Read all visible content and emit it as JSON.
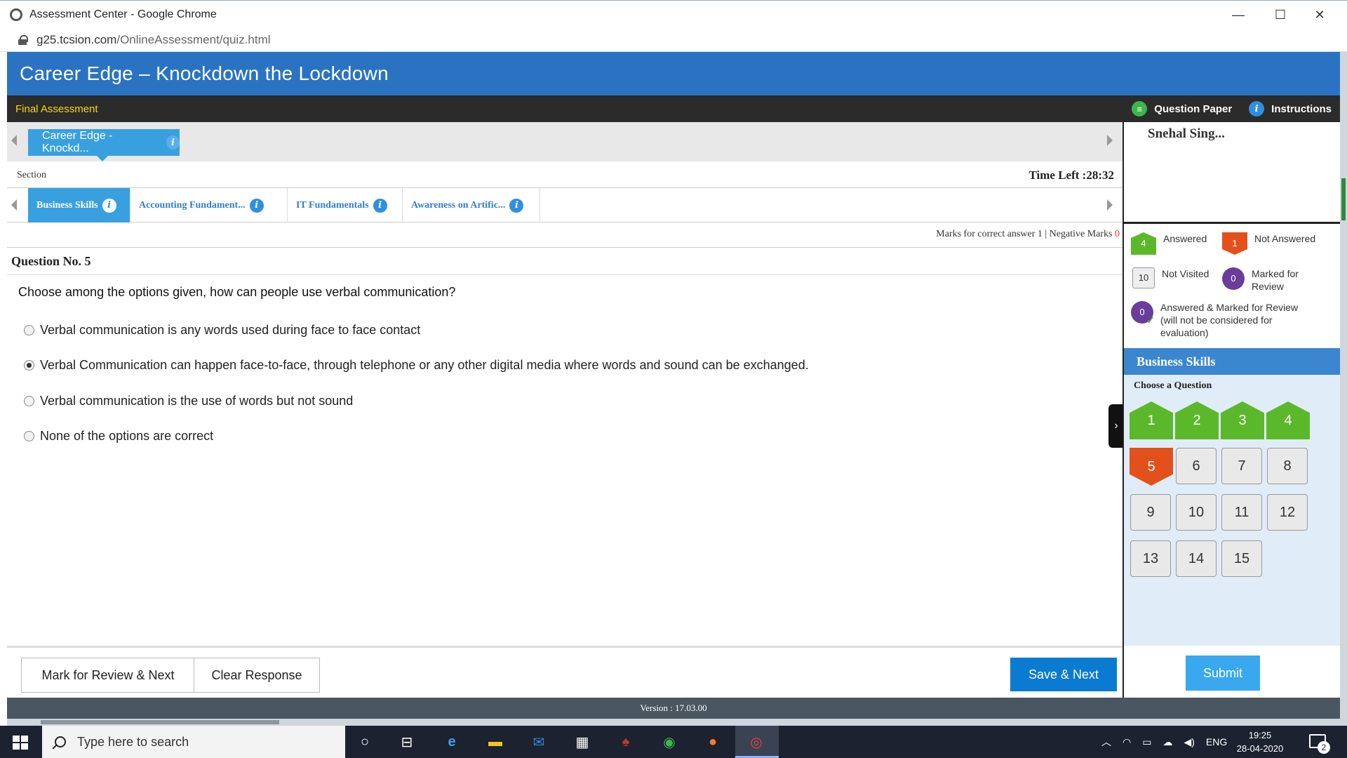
{
  "window": {
    "title": "Assessment Center - Google Chrome",
    "url_domain": "g25.tcsion.com",
    "url_path": "/OnlineAssessment/quiz.html",
    "controls": [
      "—",
      "☐",
      "✕"
    ]
  },
  "header": {
    "brand": "Career Edge – Knockdown the Lockdown",
    "assessment": "Final Assessment",
    "question_paper": "Question Paper",
    "instructions": "Instructions"
  },
  "test": {
    "tab": "Career Edge - Knockd...",
    "section_label": "Section",
    "time_left": "Time Left :28:32"
  },
  "sections": [
    {
      "label": "Business Skills",
      "active": true
    },
    {
      "label": "Accounting Fundament...",
      "active": false
    },
    {
      "label": "IT Fundamentals",
      "active": false
    },
    {
      "label": "Awareness on Artific...",
      "active": false
    }
  ],
  "marks": {
    "correct_label": "Marks for correct answer",
    "correct_value": "1",
    "separator": "|",
    "negative_label": "Negative Marks",
    "negative_value": "0"
  },
  "question": {
    "number": "Question No. 5",
    "text": "Choose among the options given, how can people use verbal communication?",
    "options": [
      {
        "text": "Verbal communication is any words used during face to face contact",
        "selected": false
      },
      {
        "text": "Verbal Communication can happen face-to-face, through telephone or any other digital media where words and sound can be exchanged.",
        "selected": true
      },
      {
        "text": "Verbal communication is the use of words but not sound",
        "selected": false
      },
      {
        "text": "None of the options are correct",
        "selected": false
      }
    ]
  },
  "buttons": {
    "mark_review": "Mark for Review & Next",
    "clear": "Clear Response",
    "save_next": "Save & Next",
    "submit": "Submit"
  },
  "user": {
    "name": "Snehal Sing..."
  },
  "legend": {
    "answered": {
      "count": "4",
      "label": "Answered"
    },
    "not_answered": {
      "count": "1",
      "label": "Not Answered"
    },
    "not_visited": {
      "count": "10",
      "label": "Not Visited"
    },
    "marked": {
      "count": "0",
      "label": "Marked for Review"
    },
    "answered_marked": {
      "count": "0",
      "label": "Answered & Marked for Review (will not be considered for evaluation)"
    }
  },
  "palette": {
    "section": "Business Skills",
    "choose": "Choose a Question",
    "questions": [
      {
        "n": "1",
        "status": "answered"
      },
      {
        "n": "2",
        "status": "answered"
      },
      {
        "n": "3",
        "status": "answered"
      },
      {
        "n": "4",
        "status": "answered"
      },
      {
        "n": "5",
        "status": "not_answered"
      },
      {
        "n": "6",
        "status": "not_visited"
      },
      {
        "n": "7",
        "status": "not_visited"
      },
      {
        "n": "8",
        "status": "not_visited"
      },
      {
        "n": "9",
        "status": "not_visited"
      },
      {
        "n": "10",
        "status": "not_visited"
      },
      {
        "n": "11",
        "status": "not_visited"
      },
      {
        "n": "12",
        "status": "not_visited"
      },
      {
        "n": "13",
        "status": "not_visited"
      },
      {
        "n": "14",
        "status": "not_visited"
      },
      {
        "n": "15",
        "status": "not_visited"
      }
    ]
  },
  "version": "Version : 17.03.00",
  "taskbar": {
    "search_placeholder": "Type here to search",
    "language": "ENG",
    "time": "19:25",
    "date": "28-04-2020",
    "notifications": "2"
  },
  "colors": {
    "header_blue": "#2a73c3",
    "answered": "#5cb82b",
    "not_answered": "#e2511c",
    "marked": "#6a3d9a",
    "save_blue": "#0b7ad1"
  }
}
